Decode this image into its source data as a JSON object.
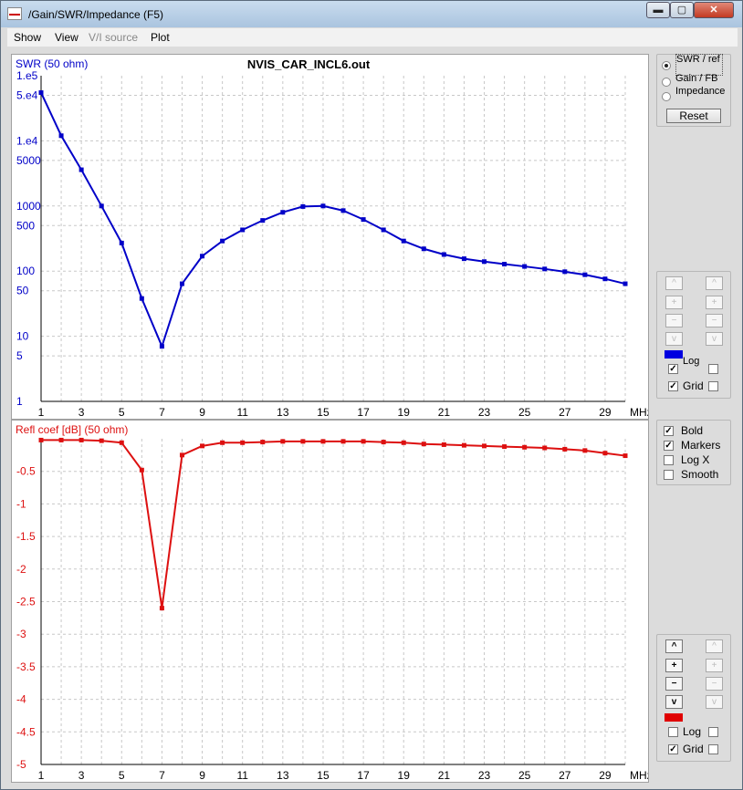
{
  "window": {
    "title": "/Gain/SWR/Impedance (F5)",
    "min_glyph": "▬",
    "max_glyph": "▢",
    "close_glyph": "✕"
  },
  "menu": {
    "show": "Show",
    "view": "View",
    "vi_source": "V/I source",
    "plot": "Plot"
  },
  "top_plot": {
    "ylabel": "SWR (50 ohm)",
    "title": "NVIS_CAR_INCL6.out",
    "ytick_labels": [
      "1.e5",
      "5.e4",
      "1.e4",
      "5000",
      "1000",
      "500",
      "100",
      "50",
      "10",
      "5",
      "1"
    ],
    "xtick_labels": [
      "1",
      "3",
      "5",
      "7",
      "9",
      "11",
      "13",
      "15",
      "17",
      "19",
      "21",
      "23",
      "25",
      "27",
      "29"
    ],
    "xunit": "MHz",
    "color": "#0000c8"
  },
  "bottom_plot": {
    "ylabel": "Refl coef [dB] (50 ohm)",
    "ytick_labels": [
      "-0.5",
      "-1",
      "-1.5",
      "-2",
      "-2.5",
      "-3",
      "-3.5",
      "-4",
      "-4.5",
      "-5"
    ],
    "xtick_labels": [
      "1",
      "3",
      "5",
      "7",
      "9",
      "11",
      "13",
      "15",
      "17",
      "19",
      "21",
      "23",
      "25",
      "27",
      "29"
    ],
    "xunit": "MHz",
    "color": "#dd1010"
  },
  "chart_data": [
    {
      "type": "line",
      "title": "NVIS_CAR_INCL6.out",
      "ylabel": "SWR (50 ohm)",
      "xlabel": "MHz",
      "yscale": "log",
      "xlim": [
        1,
        30
      ],
      "ylim": [
        1,
        100000
      ],
      "grid": true,
      "series": [
        {
          "x": [
            1,
            2,
            3,
            4,
            5,
            6,
            7,
            8,
            9,
            10,
            11,
            12,
            13,
            14,
            15,
            16,
            17,
            18,
            19,
            20,
            21,
            22,
            23,
            24,
            25,
            26,
            27,
            28,
            29,
            30
          ],
          "values": [
            55000,
            12000,
            3600,
            1000,
            270,
            38,
            7,
            64,
            170,
            290,
            430,
            600,
            800,
            980,
            1000,
            850,
            620,
            430,
            290,
            220,
            180,
            155,
            140,
            128,
            118,
            108,
            98,
            88,
            76,
            64
          ]
        }
      ]
    },
    {
      "type": "line",
      "ylabel": "Refl coef [dB] (50 ohm)",
      "xlabel": "MHz",
      "xlim": [
        1,
        30
      ],
      "ylim": [
        -5,
        0
      ],
      "grid": true,
      "series": [
        {
          "x": [
            1,
            2,
            3,
            4,
            5,
            6,
            7,
            8,
            9,
            10,
            11,
            12,
            13,
            14,
            15,
            16,
            17,
            18,
            19,
            20,
            21,
            22,
            23,
            24,
            25,
            26,
            27,
            28,
            29,
            30
          ],
          "values": [
            -0.02,
            -0.02,
            -0.02,
            -0.03,
            -0.06,
            -0.48,
            -2.6,
            -0.25,
            -0.11,
            -0.06,
            -0.06,
            -0.05,
            -0.04,
            -0.04,
            -0.04,
            -0.04,
            -0.04,
            -0.05,
            -0.06,
            -0.08,
            -0.09,
            -0.1,
            -0.11,
            -0.12,
            -0.13,
            -0.14,
            -0.16,
            -0.18,
            -0.22,
            -0.26
          ]
        }
      ]
    }
  ],
  "side1": {
    "radio_swr": "SWR / ref",
    "radio_gain": "Gain / FB",
    "radio_impedance": "Impedance",
    "reset": "Reset",
    "chk_log": "Log",
    "chk_grid": "Grid",
    "color": "#0000e0"
  },
  "side_mid": {
    "bold": "Bold",
    "markers": "Markers",
    "logx": "Log X",
    "smooth": "Smooth"
  },
  "side2": {
    "chk_log": "Log",
    "chk_grid": "Grid",
    "color": "#e00000"
  },
  "glyphs": {
    "up": "^",
    "plus": "+",
    "minus": "−",
    "down": "v",
    "check": "✓"
  }
}
